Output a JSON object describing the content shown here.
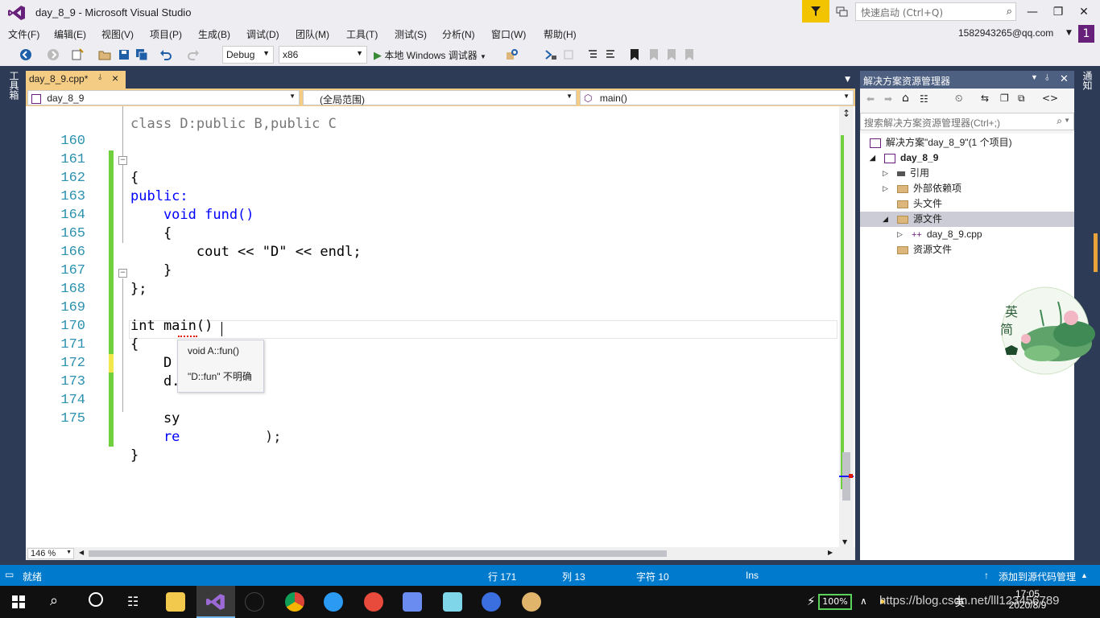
{
  "window": {
    "title": "day_8_9 - Microsoft Visual Studio",
    "quick_launch_placeholder": "快速启动 (Ctrl+Q)",
    "account": "1582943265@qq.com",
    "account_badge": "1"
  },
  "menu": [
    "文件(F)",
    "编辑(E)",
    "视图(V)",
    "项目(P)",
    "生成(B)",
    "调试(D)",
    "团队(M)",
    "工具(T)",
    "测试(S)",
    "分析(N)",
    "窗口(W)",
    "帮助(H)"
  ],
  "toolbar": {
    "config": "Debug",
    "platform": "x86",
    "debug_label": "本地 Windows 调试器"
  },
  "left_strip": {
    "toolbox": "工具箱"
  },
  "editor": {
    "tab_label": "day_8_9.cpp*",
    "nav_project": "day_8_9",
    "nav_scope": "(全局范围)",
    "nav_function": "main()",
    "zoom": "146 %",
    "lines": [
      {
        "n": "160",
        "text": "{"
      },
      {
        "n": "161",
        "text": "public:"
      },
      {
        "n": "162",
        "text": "    void fund()"
      },
      {
        "n": "163",
        "text": "    {"
      },
      {
        "n": "164",
        "text": "        cout << \"D\" << endl;"
      },
      {
        "n": "165",
        "text": "    }"
      },
      {
        "n": "166",
        "text": "};"
      },
      {
        "n": "167",
        "text": ""
      },
      {
        "n": "168",
        "text": "int main()"
      },
      {
        "n": "169",
        "text": "{"
      },
      {
        "n": "170",
        "text": "    D d;"
      },
      {
        "n": "171",
        "text": "    d.fun();"
      },
      {
        "n": "172",
        "text": ""
      },
      {
        "n": "173",
        "text": "    sy"
      },
      {
        "n": "174",
        "text": "    re"
      },
      {
        "n": "175",
        "text": "}"
      }
    ],
    "partial_top_line": "class D:public B,public C",
    "line173_tail": ");",
    "tooltip": {
      "signature": "void A::fun()",
      "error": "\"D::fun\" 不明确"
    }
  },
  "solution_explorer": {
    "title": "解决方案资源管理器",
    "search_placeholder": "搜索解决方案资源管理器(Ctrl+;)",
    "items": [
      {
        "label": "解决方案\"day_8_9\"(1 个项目)"
      },
      {
        "label": "day_8_9"
      },
      {
        "label": "引用"
      },
      {
        "label": "外部依赖项"
      },
      {
        "label": "头文件"
      },
      {
        "label": "源文件"
      },
      {
        "label": "day_8_9.cpp"
      },
      {
        "label": "资源文件"
      }
    ]
  },
  "notifications_tab": "通知",
  "sticker": {
    "line1": "英",
    "line2": "简"
  },
  "statusbar": {
    "ready": "就绪",
    "row": "行 171",
    "col": "列 13",
    "char": "字符 10",
    "ins": "Ins",
    "source_control": "添加到源代码管理"
  },
  "taskbar": {
    "battery": "100%",
    "ime": "英",
    "time": "17:05",
    "date": "2020/8/9",
    "watermark": "https://blog.csdn.net/lll123456789"
  },
  "colors": {
    "title_bg": "#eeeef2",
    "vs_purple": "#68217a",
    "tab_active": "#f5cc84",
    "status_blue": "#007acc",
    "dark_chrome": "#2d3b56",
    "change_green": "#6fcf3c",
    "change_yellow": "#f2e84c"
  }
}
